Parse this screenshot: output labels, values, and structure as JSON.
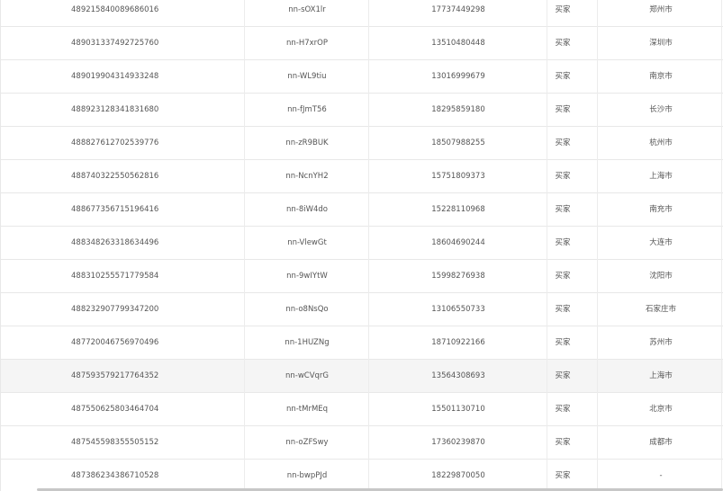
{
  "table": {
    "rows": [
      {
        "id": "489215840089686016",
        "nickname": "nn-sOX1lr",
        "phone": "17737449298",
        "role": "买家",
        "city": "郑州市"
      },
      {
        "id": "489031337492725760",
        "nickname": "nn-H7xrOP",
        "phone": "13510480448",
        "role": "买家",
        "city": "深圳市"
      },
      {
        "id": "489019904314933248",
        "nickname": "nn-WL9tiu",
        "phone": "13016999679",
        "role": "买家",
        "city": "南京市"
      },
      {
        "id": "488923128341831680",
        "nickname": "nn-fJmT56",
        "phone": "18295859180",
        "role": "买家",
        "city": "长沙市"
      },
      {
        "id": "488827612702539776",
        "nickname": "nn-zR9BUK",
        "phone": "18507988255",
        "role": "买家",
        "city": "杭州市"
      },
      {
        "id": "488740322550562816",
        "nickname": "nn-NcnYH2",
        "phone": "15751809373",
        "role": "买家",
        "city": "上海市"
      },
      {
        "id": "488677356715196416",
        "nickname": "nn-8iW4do",
        "phone": "15228110968",
        "role": "买家",
        "city": "南充市"
      },
      {
        "id": "488348263318634496",
        "nickname": "nn-VlewGt",
        "phone": "18604690244",
        "role": "买家",
        "city": "大连市"
      },
      {
        "id": "488310255571779584",
        "nickname": "nn-9wIYtW",
        "phone": "15998276938",
        "role": "买家",
        "city": "沈阳市"
      },
      {
        "id": "488232907799347200",
        "nickname": "nn-o8NsQo",
        "phone": "13106550733",
        "role": "买家",
        "city": "石家庄市"
      },
      {
        "id": "487720046756970496",
        "nickname": "nn-1HUZNg",
        "phone": "18710922166",
        "role": "买家",
        "city": "苏州市"
      },
      {
        "id": "487593579217764352",
        "nickname": "nn-wCVqrG",
        "phone": "13564308693",
        "role": "买家",
        "city": "上海市"
      },
      {
        "id": "487550625803464704",
        "nickname": "nn-tMrMEq",
        "phone": "15501130710",
        "role": "买家",
        "city": "北京市"
      },
      {
        "id": "487545598355505152",
        "nickname": "nn-oZFSwy",
        "phone": "17360239870",
        "role": "买家",
        "city": "成都市"
      },
      {
        "id": "487386234386710528",
        "nickname": "nn-bwpPJd",
        "phone": "18229870050",
        "role": "买家",
        "city": "-"
      }
    ],
    "hover_row_index": 11
  }
}
